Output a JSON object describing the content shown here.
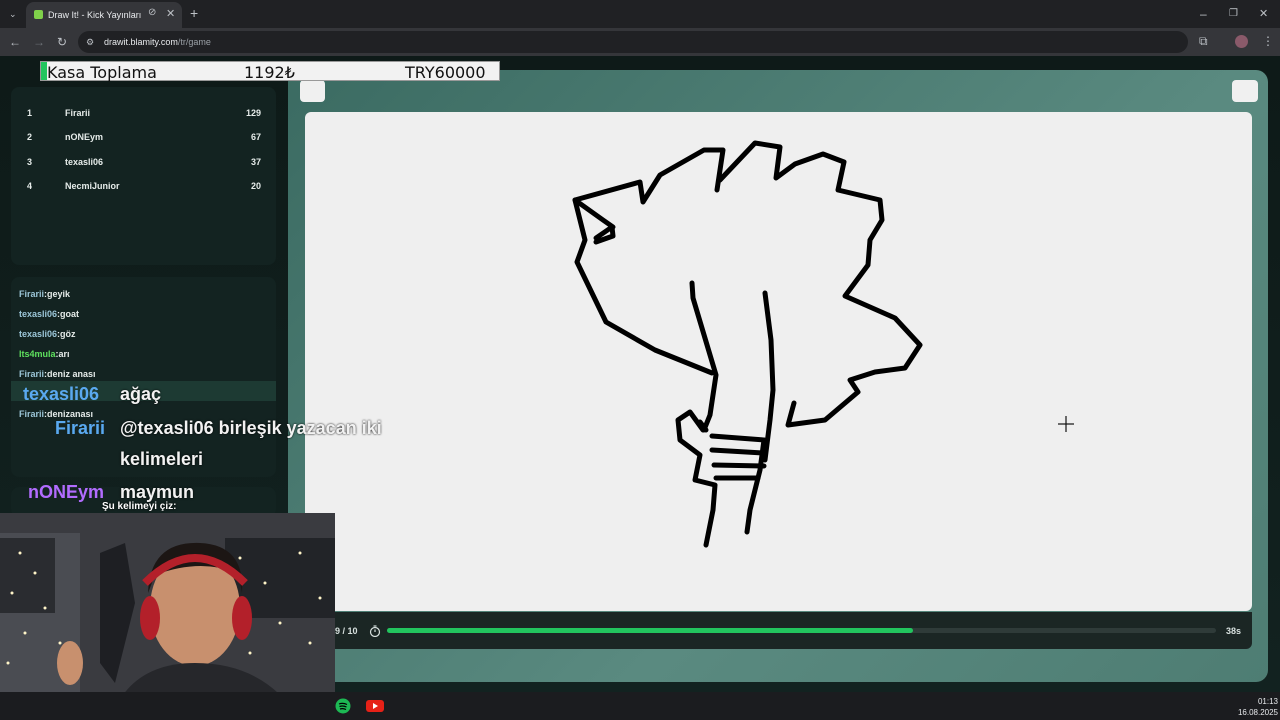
{
  "browser": {
    "tab_title": "Draw It! - Kick Yayınları İçin",
    "url_host": "drawit.blamity.com",
    "url_path": "/tr/game",
    "new_tab": "+",
    "tab_close": "✕"
  },
  "overlay": {
    "kasa_label": "Kasa Toplama",
    "kasa_amount": "1192₺",
    "kasa_goal": "TRY60000",
    "chat": [
      {
        "user": "texasli06",
        "message": "ağaç",
        "user_color": "#5aa9f0"
      },
      {
        "user": "Firarii",
        "message": "@texasli06 birleşik yazacan iki",
        "message_cont": "kelimeleri",
        "user_color": "#5aa9f0"
      },
      {
        "user": "nONEym",
        "message": "maymun",
        "user_color": "#b26cff"
      }
    ],
    "draw_prompt": "Şu kelimeyi çiz:"
  },
  "scoreboard": [
    {
      "rank": "1",
      "name": "Firarii",
      "points": "129"
    },
    {
      "rank": "2",
      "name": "nONEym",
      "points": "67"
    },
    {
      "rank": "3",
      "name": "texasli06",
      "points": "37"
    },
    {
      "rank": "4",
      "name": "NecmiJunior",
      "points": "20"
    }
  ],
  "game_chat": [
    {
      "user": "Firarii",
      "message": "geyik"
    },
    {
      "user": "texasli06",
      "message": "goat"
    },
    {
      "user": "texasli06",
      "message": "göz"
    },
    {
      "user": "Its4mula",
      "message": "arı",
      "user_color": "#5ee05e"
    },
    {
      "user": "Firarii",
      "message": "deniz anası"
    },
    {
      "user": "Firarii",
      "message": "denizanası"
    }
  ],
  "game": {
    "round": "9 / 10",
    "time_left": "38s",
    "progress_fraction": 0.635
  },
  "taskbar": {
    "time": "01:13",
    "date": "16.08.2025"
  },
  "colors": {
    "progress": "#22c55e",
    "canvas": "#efefef",
    "accent_green": "#22c55e"
  }
}
